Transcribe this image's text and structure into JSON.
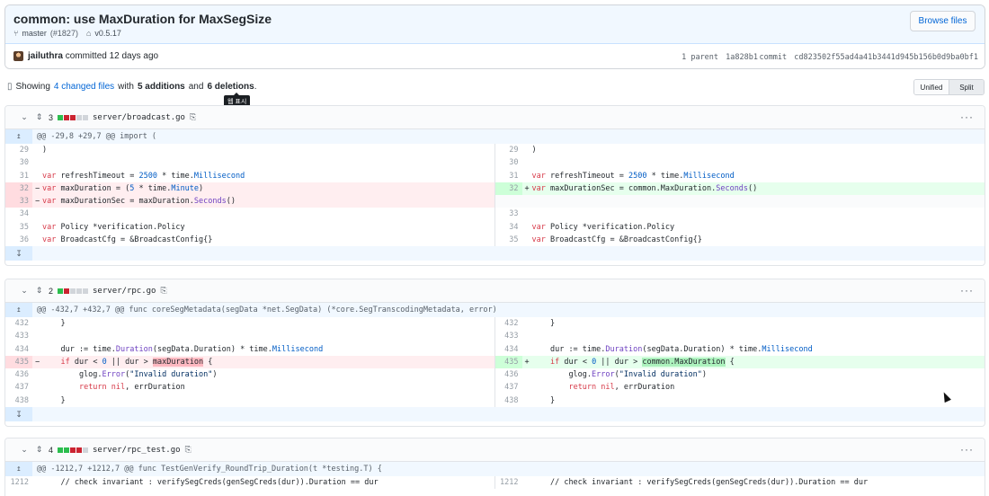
{
  "commit": {
    "title": "common: use MaxDuration for MaxSegSize",
    "branch": "master",
    "pr": "(#1827)",
    "tag": "v0.5.17",
    "browse_label": "Browse files",
    "author": "jailuthra",
    "action": "committed",
    "when": "12 days ago",
    "parent_label": "1 parent",
    "parent_sha": "1a828b1",
    "commit_label": "commit",
    "commit_sha": "cd823502f55ad4a41b3441d945b156b0d9ba0bf1"
  },
  "summary": {
    "prefix": "Showing",
    "changed": "4 changed files",
    "with": "with",
    "additions": "5 additions",
    "and": "and",
    "deletions": "6 deletions",
    "period": ".",
    "tooltip": "웹 표시"
  },
  "view_toggle": {
    "unified": "Unified",
    "split": "Split"
  },
  "files": [
    {
      "count": "3",
      "blocks": [
        "a",
        "d",
        "d",
        "n",
        "n"
      ],
      "name": "server/broadcast.go",
      "hunk": "@@ -29,8 +29,7 @@ import (",
      "rows": [
        {
          "l": {
            "n": "29",
            "t": "ctx",
            "c": ")"
          },
          "r": {
            "n": "29",
            "t": "ctx",
            "c": ")"
          }
        },
        {
          "l": {
            "n": "30",
            "t": "ctx",
            "c": ""
          },
          "r": {
            "n": "30",
            "t": "ctx",
            "c": ""
          }
        },
        {
          "l": {
            "n": "31",
            "t": "ctx",
            "c": "var refreshTimeout = 2500 * time.Millisecond"
          },
          "r": {
            "n": "31",
            "t": "ctx",
            "c": "var refreshTimeout = 2500 * time.Millisecond"
          }
        },
        {
          "l": {
            "n": "32",
            "t": "del",
            "c": "var maxDuration = (5 * time.Minute)"
          },
          "r": {
            "n": "32",
            "t": "add",
            "c": "var maxDurationSec = common.MaxDuration.Seconds()"
          }
        },
        {
          "l": {
            "n": "33",
            "t": "del",
            "c": "var maxDurationSec = maxDuration.Seconds()"
          },
          "r": {
            "n": "",
            "t": "empty",
            "c": ""
          }
        },
        {
          "l": {
            "n": "34",
            "t": "ctx",
            "c": ""
          },
          "r": {
            "n": "33",
            "t": "ctx",
            "c": ""
          }
        },
        {
          "l": {
            "n": "35",
            "t": "ctx",
            "c": "var Policy *verification.Policy"
          },
          "r": {
            "n": "34",
            "t": "ctx",
            "c": "var Policy *verification.Policy"
          }
        },
        {
          "l": {
            "n": "36",
            "t": "ctx",
            "c": "var BroadcastCfg = &BroadcastConfig{}"
          },
          "r": {
            "n": "35",
            "t": "ctx",
            "c": "var BroadcastCfg = &BroadcastConfig{}"
          }
        }
      ]
    },
    {
      "count": "2",
      "blocks": [
        "a",
        "d",
        "n",
        "n",
        "n"
      ],
      "name": "server/rpc.go",
      "hunk": "@@ -432,7 +432,7 @@ func coreSegMetadata(segData *net.SegData) (*core.SegTranscodingMetadata, error)",
      "rows": [
        {
          "l": {
            "n": "432",
            "t": "ctx",
            "c": "\t}"
          },
          "r": {
            "n": "432",
            "t": "ctx",
            "c": "\t}"
          }
        },
        {
          "l": {
            "n": "433",
            "t": "ctx",
            "c": ""
          },
          "r": {
            "n": "433",
            "t": "ctx",
            "c": ""
          }
        },
        {
          "l": {
            "n": "434",
            "t": "ctx",
            "c": "\tdur := time.Duration(segData.Duration) * time.Millisecond"
          },
          "r": {
            "n": "434",
            "t": "ctx",
            "c": "\tdur := time.Duration(segData.Duration) * time.Millisecond"
          }
        },
        {
          "l": {
            "n": "435",
            "t": "del",
            "c": "\tif dur < 0 || dur > maxDuration {"
          },
          "r": {
            "n": "435",
            "t": "add",
            "c": "\tif dur < 0 || dur > common.MaxDuration {"
          }
        },
        {
          "l": {
            "n": "436",
            "t": "ctx",
            "c": "\t\tglog.Error(\"Invalid duration\")"
          },
          "r": {
            "n": "436",
            "t": "ctx",
            "c": "\t\tglog.Error(\"Invalid duration\")"
          }
        },
        {
          "l": {
            "n": "437",
            "t": "ctx",
            "c": "\t\treturn nil, errDuration"
          },
          "r": {
            "n": "437",
            "t": "ctx",
            "c": "\t\treturn nil, errDuration"
          }
        },
        {
          "l": {
            "n": "438",
            "t": "ctx",
            "c": "\t}"
          },
          "r": {
            "n": "438",
            "t": "ctx",
            "c": "\t}"
          }
        }
      ]
    },
    {
      "count": "4",
      "blocks": [
        "a",
        "a",
        "d",
        "d",
        "n"
      ],
      "name": "server/rpc_test.go",
      "hunk": "@@ -1212,7 +1212,7 @@ func TestGenVerify_RoundTrip_Duration(t *testing.T) {",
      "rows": [
        {
          "l": {
            "n": "1212",
            "t": "ctx",
            "c": "\t// check invariant : verifySegCreds(genSegCreds(dur)).Duration == dur"
          },
          "r": {
            "n": "1212",
            "t": "ctx",
            "c": "\t// check invariant : verifySegCreds(genSegCreds(dur)).Duration == dur"
          }
        }
      ]
    }
  ]
}
